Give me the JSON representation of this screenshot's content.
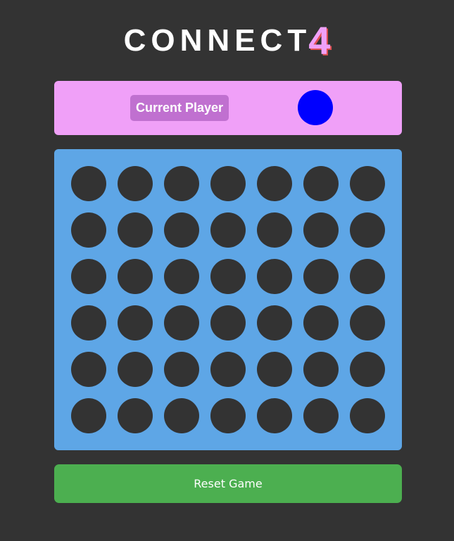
{
  "header": {
    "title_text": "CONNECT",
    "title_number": "4"
  },
  "status": {
    "label": "Current Player",
    "current_player_color": "#0000ff"
  },
  "board": {
    "rows": 6,
    "columns": 7,
    "empty_color": "#333333",
    "cells": [
      [
        "empty",
        "empty",
        "empty",
        "empty",
        "empty",
        "empty",
        "empty"
      ],
      [
        "empty",
        "empty",
        "empty",
        "empty",
        "empty",
        "empty",
        "empty"
      ],
      [
        "empty",
        "empty",
        "empty",
        "empty",
        "empty",
        "empty",
        "empty"
      ],
      [
        "empty",
        "empty",
        "empty",
        "empty",
        "empty",
        "empty",
        "empty"
      ],
      [
        "empty",
        "empty",
        "empty",
        "empty",
        "empty",
        "empty",
        "empty"
      ],
      [
        "empty",
        "empty",
        "empty",
        "empty",
        "empty",
        "empty",
        "empty"
      ]
    ]
  },
  "controls": {
    "reset_label": "Reset Game"
  },
  "colors": {
    "background": "#333333",
    "title_accent": "#f0a0f8",
    "panel": "#f0a0f8",
    "label_bg": "#c070d0",
    "board": "#5ea6e6",
    "reset_button": "#4caf50"
  }
}
